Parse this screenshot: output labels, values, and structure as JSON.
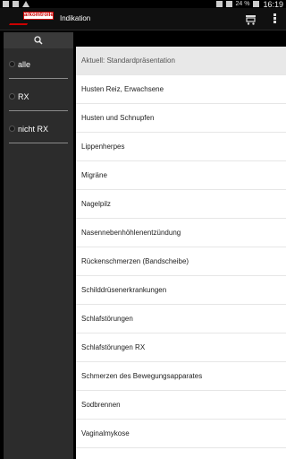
{
  "status_bar": {
    "battery": "24 %",
    "time": "16:19"
  },
  "action_bar": {
    "logo_text": "arkomtrolle",
    "title": "Indikation"
  },
  "sidebar": {
    "filters": [
      {
        "label": "alle"
      },
      {
        "label": "RX"
      },
      {
        "label": "nicht RX"
      }
    ]
  },
  "list": {
    "current": "Aktuell: Standardpräsentation",
    "items": [
      "Husten Reiz,  Erwachsene",
      "Husten und Schnupfen",
      "Lippenherpes",
      "Migräne",
      "Nagelpilz",
      "Nasennebenhöhlenentzündung",
      "Rückenschmerzen (Bandscheibe)",
      "Schilddrüsenerkrankungen",
      "Schlafstörungen",
      "Schlafstörungen RX",
      "Schmerzen des Bewegungsapparates",
      "Sodbrennen",
      "Vaginalmykose"
    ]
  }
}
